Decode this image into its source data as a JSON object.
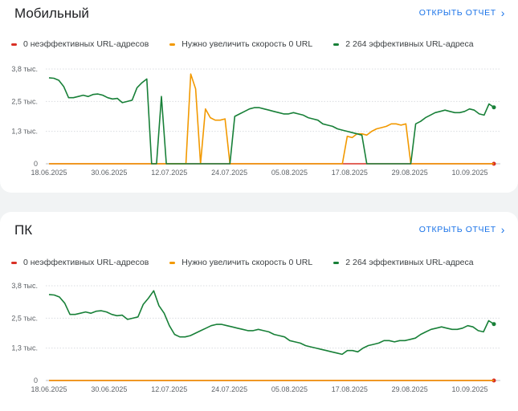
{
  "colors": {
    "red": "#d93025",
    "orange": "#f29900",
    "green": "#188038",
    "grid": "#dadce0",
    "axis": "#5f6368"
  },
  "cards": [
    {
      "title": "Мобильный",
      "open_report": "ОТКРЫТЬ ОТЧЕТ",
      "legend": [
        "0 неэффективных URL-адресов",
        "Нужно увеличить скорость 0 URL",
        "2 264 эффективных URL-адреса"
      ]
    },
    {
      "title": "ПК",
      "open_report": "ОТКРЫТЬ ОТЧЕТ",
      "legend": [
        "0 неэффективных URL-адресов",
        "Нужно увеличить скорость 0 URL",
        "2 264 эффективных URL-адреса"
      ]
    }
  ],
  "chart_data": [
    {
      "type": "line",
      "title": "Мобильный",
      "x_start": "18.06.2025",
      "x_end": "14.09.2025",
      "x_tick_labels": [
        "18.06.2025",
        "30.06.2025",
        "12.07.2025",
        "24.07.2025",
        "05.08.2025",
        "17.08.2025",
        "29.08.2025",
        "10.09.2025"
      ],
      "y_tick_labels": [
        "3,8 тыс.",
        "2,5 тыс.",
        "1,3 тыс.",
        "0"
      ],
      "y_ticks": [
        3800,
        2500,
        1300,
        0
      ],
      "ylim": [
        0,
        3800
      ],
      "grid": true,
      "legend_position": "top-left",
      "series": [
        {
          "name": "0 неэффективных URL-адресов",
          "color": "red",
          "values": [
            0,
            0
          ]
        },
        {
          "name": "Нужно увеличить скорость 0 URL",
          "color": "orange",
          "values": [
            0,
            0,
            0,
            0,
            0,
            0,
            0,
            0,
            0,
            0,
            0,
            0,
            0,
            0,
            0,
            0,
            0,
            0,
            0,
            0,
            0,
            0,
            0,
            0,
            0,
            0,
            0,
            0,
            0,
            3600,
            3000,
            0,
            2200,
            1850,
            1750,
            1750,
            1800,
            0,
            0,
            0,
            0,
            0,
            0,
            0,
            0,
            0,
            0,
            0,
            0,
            0,
            0,
            0,
            0,
            0,
            0,
            0,
            0,
            0,
            0,
            0,
            0,
            1100,
            1050,
            1200,
            1200,
            1150,
            1300,
            1400,
            1450,
            1500,
            1600,
            1600,
            1550,
            1600,
            0,
            0,
            0,
            0,
            0,
            0,
            0,
            0,
            0,
            0,
            0,
            0,
            0,
            0,
            0,
            0,
            0,
            0
          ]
        },
        {
          "name": "2 264 эффективных URL-адреса",
          "color": "green",
          "values": [
            3450,
            3430,
            3350,
            3100,
            2650,
            2650,
            2700,
            2750,
            2700,
            2780,
            2800,
            2750,
            2650,
            2600,
            2620,
            2450,
            2500,
            2550,
            3050,
            3250,
            3400,
            0,
            0,
            2700,
            0,
            0,
            0,
            0,
            0,
            0,
            0,
            0,
            0,
            0,
            0,
            0,
            0,
            0,
            1900,
            2000,
            2100,
            2200,
            2250,
            2250,
            2200,
            2150,
            2100,
            2050,
            2000,
            2000,
            2050,
            2000,
            1950,
            1850,
            1800,
            1750,
            1600,
            1550,
            1500,
            1400,
            1350,
            1300,
            1250,
            1200,
            1150,
            0,
            0,
            0,
            0,
            0,
            0,
            0,
            0,
            0,
            0,
            1600,
            1700,
            1850,
            1950,
            2050,
            2100,
            2150,
            2100,
            2050,
            2050,
            2100,
            2200,
            2150,
            2000,
            1950,
            2400,
            2264
          ]
        }
      ]
    },
    {
      "type": "line",
      "title": "ПК",
      "x_start": "18.06.2025",
      "x_end": "14.09.2025",
      "x_tick_labels": [
        "18.06.2025",
        "30.06.2025",
        "12.07.2025",
        "24.07.2025",
        "05.08.2025",
        "17.08.2025",
        "29.08.2025",
        "10.09.2025"
      ],
      "y_tick_labels": [
        "3,8 тыс.",
        "2,5 тыс.",
        "1,3 тыс.",
        "0"
      ],
      "y_ticks": [
        3800,
        2500,
        1300,
        0
      ],
      "ylim": [
        0,
        3800
      ],
      "grid": true,
      "legend_position": "top-left",
      "series": [
        {
          "name": "0 неэффективных URL-адресов",
          "color": "red",
          "values": [
            0,
            0
          ]
        },
        {
          "name": "Нужно увеличить скорость 0 URL",
          "color": "orange",
          "values": [
            0,
            0
          ]
        },
        {
          "name": "2 264 эффективных URL-адреса",
          "color": "green",
          "values": [
            3450,
            3430,
            3350,
            3100,
            2650,
            2650,
            2700,
            2750,
            2700,
            2780,
            2800,
            2750,
            2650,
            2600,
            2620,
            2450,
            2500,
            2550,
            3050,
            3300,
            3600,
            3000,
            2700,
            2200,
            1850,
            1750,
            1750,
            1800,
            1900,
            2000,
            2100,
            2200,
            2250,
            2250,
            2200,
            2150,
            2100,
            2050,
            2000,
            2000,
            2050,
            2000,
            1950,
            1850,
            1800,
            1750,
            1600,
            1550,
            1500,
            1400,
            1350,
            1300,
            1250,
            1200,
            1150,
            1100,
            1050,
            1200,
            1200,
            1150,
            1300,
            1400,
            1450,
            1500,
            1600,
            1600,
            1550,
            1600,
            1600,
            1650,
            1700,
            1850,
            1950,
            2050,
            2100,
            2150,
            2100,
            2050,
            2050,
            2100,
            2200,
            2150,
            2000,
            1950,
            2400,
            2264
          ]
        }
      ]
    }
  ]
}
